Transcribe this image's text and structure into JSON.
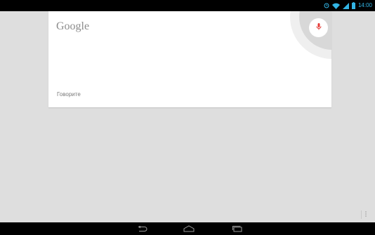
{
  "status_bar": {
    "time": "14:00",
    "icons": [
      "alarm-icon",
      "wifi-icon",
      "signal-icon",
      "battery-icon"
    ]
  },
  "search_card": {
    "logo_text": "Google",
    "prompt_text": "Говорите",
    "mic_icon": "microphone-icon"
  },
  "nav_bar": {
    "buttons": [
      "back-icon",
      "home-icon",
      "recent-apps-icon"
    ]
  },
  "overflow_menu": {
    "icon": "more-vert-icon"
  },
  "colors": {
    "accent": "#33b5e5",
    "mic": "#e53935",
    "background": "#dedede"
  }
}
